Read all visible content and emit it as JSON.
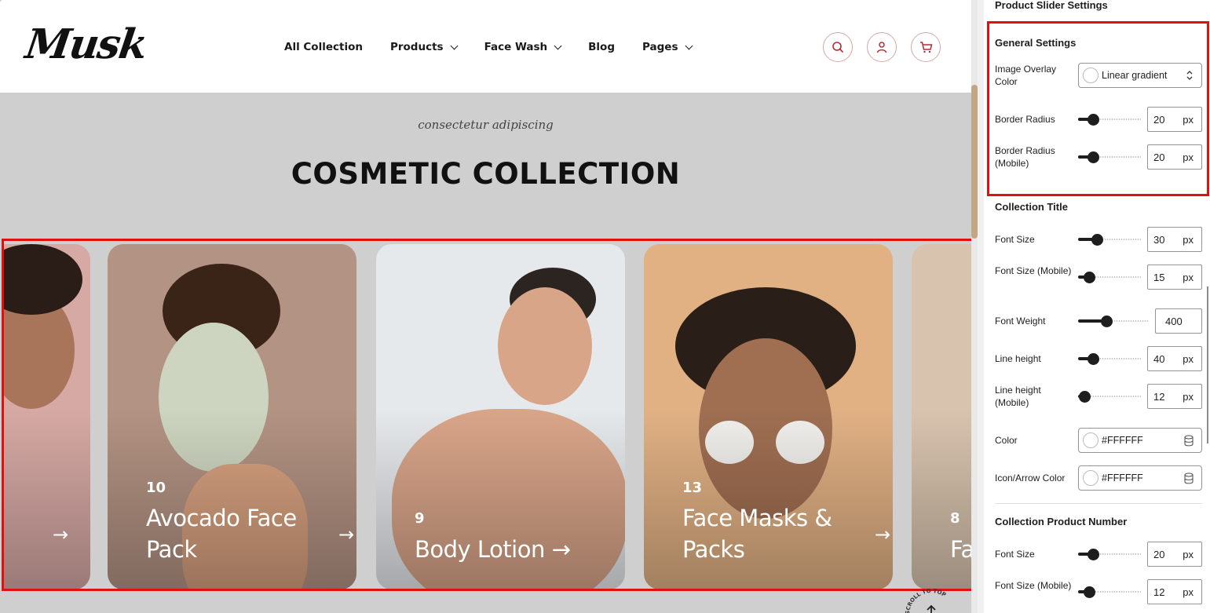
{
  "site": {
    "logo": "Musk",
    "nav": [
      {
        "label": "All Collection",
        "dropdown": false
      },
      {
        "label": "Products",
        "dropdown": true
      },
      {
        "label": "Face Wash",
        "dropdown": true
      },
      {
        "label": "Blog",
        "dropdown": false
      },
      {
        "label": "Pages",
        "dropdown": true
      }
    ],
    "icons": [
      "search-icon",
      "user-icon",
      "cart-icon"
    ],
    "tagline": "consectetur adipiscing",
    "section_title": "COSMETIC COLLECTION",
    "scroll_top_label": "SCROLL TO TOP"
  },
  "slider": {
    "cards": [
      {
        "number": "",
        "title": "",
        "bg": "#d6a9a4"
      },
      {
        "number": "10",
        "title": "Avocado Face Pack",
        "title_lines": [
          "Avocado Face",
          "Pack"
        ],
        "bg": "#b39383"
      },
      {
        "number": "9",
        "title": "Body Lotion",
        "title_lines": [
          "Body Lotion →"
        ],
        "bg": "#e6e9ec"
      },
      {
        "number": "13",
        "title": "Face Masks & Packs",
        "title_lines": [
          "Face Masks &",
          "Packs"
        ],
        "bg": "#e1b184"
      },
      {
        "number": "8",
        "title": "Fa",
        "title_lines": [
          "Fa"
        ],
        "bg": "#d8c3ae"
      }
    ],
    "arrow_glyph": "→"
  },
  "panel": {
    "title": "Product Slider Settings",
    "general": {
      "title": "General Settings",
      "overlay_label": "Image Overlay Color",
      "overlay_value": "Linear gradient",
      "border_radius_label": "Border Radius",
      "border_radius_value": "20",
      "border_radius_mobile_label": "Border Radius (Mobile)",
      "border_radius_mobile_value": "20"
    },
    "collection_title": {
      "title": "Collection Title",
      "font_size_label": "Font Size",
      "font_size_value": "30",
      "font_size_mobile_label": "Font Size (Mobile)",
      "font_size_mobile_value": "15",
      "font_weight_label": "Font Weight",
      "font_weight_value": "400",
      "line_height_label": "Line height",
      "line_height_value": "40",
      "line_height_mobile_label": "Line height (Mobile)",
      "line_height_mobile_value": "12",
      "color_label": "Color",
      "color_value": "#FFFFFF",
      "icon_color_label": "Icon/Arrow Color",
      "icon_color_value": "#FFFFFF"
    },
    "product_number": {
      "title": "Collection Product Number",
      "font_size_label": "Font Size",
      "font_size_value": "20",
      "font_size_mobile_label": "Font Size (Mobile)",
      "font_size_mobile_value": "12"
    },
    "unit": "px"
  },
  "colors": {
    "highlight": "#e01010",
    "accent": "#b52b35",
    "scroll_thumb": "#c3a684"
  }
}
